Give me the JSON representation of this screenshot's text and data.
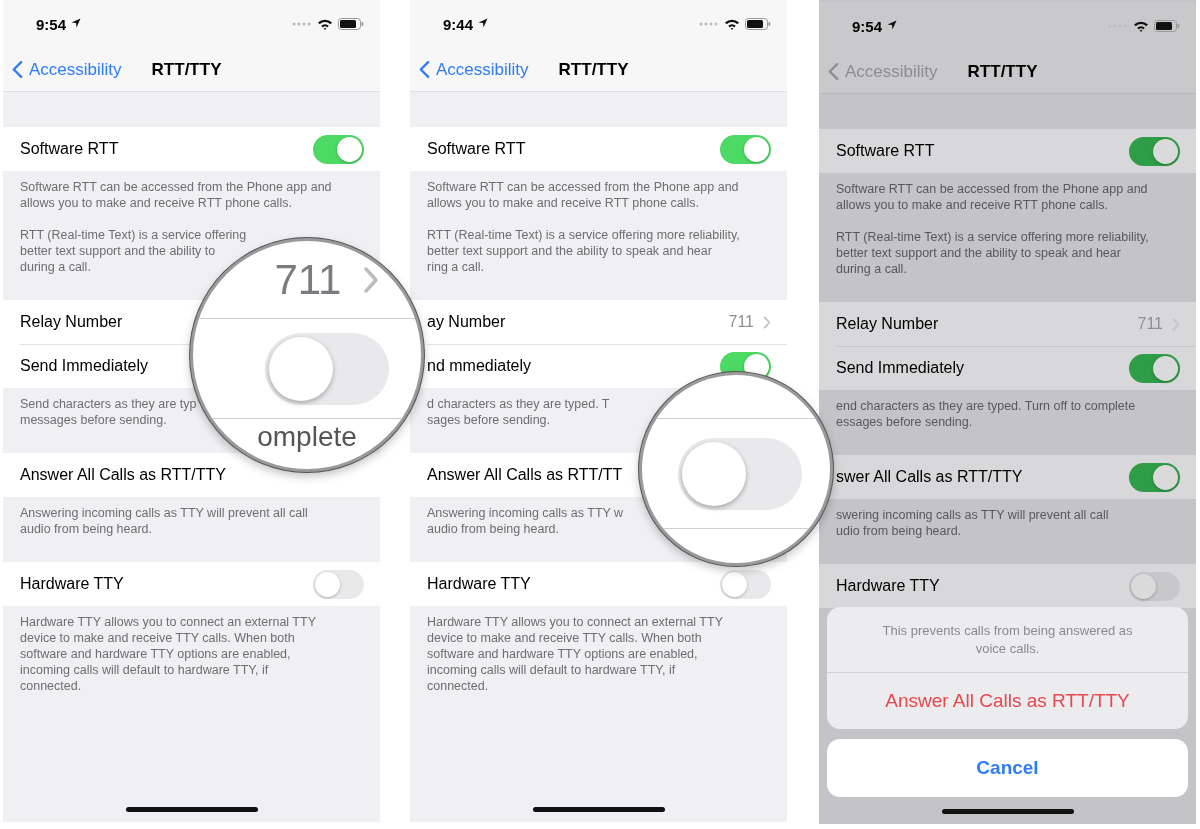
{
  "panels": [
    {
      "time": "9:54",
      "dimmed": false,
      "back": "Accessibility",
      "title": "RTT/TTY",
      "groups": [
        {
          "rows": [
            {
              "kind": "toggle",
              "label": "Software RTT",
              "on": true
            }
          ],
          "footer": [
            [
              "Software RTT can be accessed from the Phone app and",
              "allows you to make and receive RTT phone calls."
            ],
            [
              "RTT (Real-time Text) is a service offering",
              "better text support and the ability to",
              "during a call."
            ]
          ]
        },
        {
          "rows": [
            {
              "kind": "plain",
              "label": "Relay Number"
            },
            {
              "kind": "plain",
              "label": "Send Immediately"
            }
          ],
          "footer": [
            [
              "Send characters as they are typ",
              "messages before sending."
            ]
          ]
        },
        {
          "rows": [
            {
              "kind": "plain",
              "label": "Answer All Calls as RTT/TTY"
            }
          ],
          "footer": [
            [
              "Answering incoming calls as TTY will prevent all call",
              "audio from being heard."
            ]
          ]
        },
        {
          "rows": [
            {
              "kind": "toggle",
              "label": "Hardware TTY",
              "on": false
            }
          ],
          "footer": [
            [
              "Hardware TTY allows you to connect an external TTY",
              "device to make and receive TTY calls. When both",
              "software and hardware TTY options are enabled,",
              "incoming calls will default to hardware TTY, if",
              "connected."
            ]
          ]
        }
      ]
    },
    {
      "time": "9:44",
      "dimmed": false,
      "back": "Accessibility",
      "title": "RTT/TTY",
      "groups": [
        {
          "rows": [
            {
              "kind": "toggle",
              "label": "Software RTT",
              "on": true
            }
          ],
          "footer": [
            [
              "Software RTT can be accessed from the Phone app and",
              "allows you to make and receive RTT phone calls."
            ],
            [
              "RTT (Real-time Text) is a service offering more reliability,",
              "better text support and the ability to speak and hear",
              "ring a call."
            ]
          ]
        },
        {
          "rows": [
            {
              "kind": "link",
              "label": "ay Number",
              "value": "711"
            },
            {
              "kind": "toggle",
              "label": "nd mmediately",
              "on": true
            }
          ],
          "footer": [
            [
              "d characters as they are typed. T",
              "sages before sending."
            ]
          ]
        },
        {
          "rows": [
            {
              "kind": "plain",
              "label": "Answer All Calls as RTT/TT"
            }
          ],
          "footer": [
            [
              "Answering incoming calls as TTY w",
              "audio from being heard."
            ]
          ]
        },
        {
          "rows": [
            {
              "kind": "toggle",
              "label": "Hardware TTY",
              "on": false
            }
          ],
          "footer": [
            [
              "Hardware TTY allows you to connect an external TTY",
              "device to make and receive TTY calls. When both",
              "software and hardware TTY options are enabled,",
              "incoming calls will default to hardware TTY, if",
              "connected."
            ]
          ]
        }
      ]
    },
    {
      "time": "9:54",
      "dimmed": true,
      "back": "Accessibility",
      "title": "RTT/TTY",
      "groups": [
        {
          "rows": [
            {
              "kind": "toggle",
              "label": "Software RTT",
              "on": true
            }
          ],
          "footer": [
            [
              "Software RTT can be accessed from the Phone app and",
              "allows you to make and receive RTT phone calls."
            ],
            [
              "RTT (Real-time Text) is a service offering more reliability,",
              "better text support and the ability to speak and hear",
              "during a call."
            ]
          ]
        },
        {
          "rows": [
            {
              "kind": "link",
              "label": "Relay Number",
              "value": "711"
            },
            {
              "kind": "toggle",
              "label": "Send Immediately",
              "on": true
            }
          ],
          "footer": [
            [
              "end characters as they are typed. Turn off to complete",
              "essages before sending."
            ]
          ]
        },
        {
          "rows": [
            {
              "kind": "toggle",
              "label": "swer All Calls as RTT/TTY",
              "on": true
            }
          ],
          "footer": [
            [
              "swering incoming calls as TTY will prevent all call",
              "udio from being heard."
            ]
          ]
        },
        {
          "rows": [
            {
              "kind": "toggle",
              "label": "Hardware TTY",
              "on": false
            }
          ]
        }
      ],
      "action_sheet": {
        "message": "This prevents calls from being answered as voice calls.",
        "action": "Answer All Calls as RTT/TTY",
        "cancel": "Cancel"
      }
    }
  ],
  "magnifiers": [
    {
      "value": "711",
      "on": false,
      "fragment": "omplete"
    },
    {
      "on": false
    }
  ]
}
